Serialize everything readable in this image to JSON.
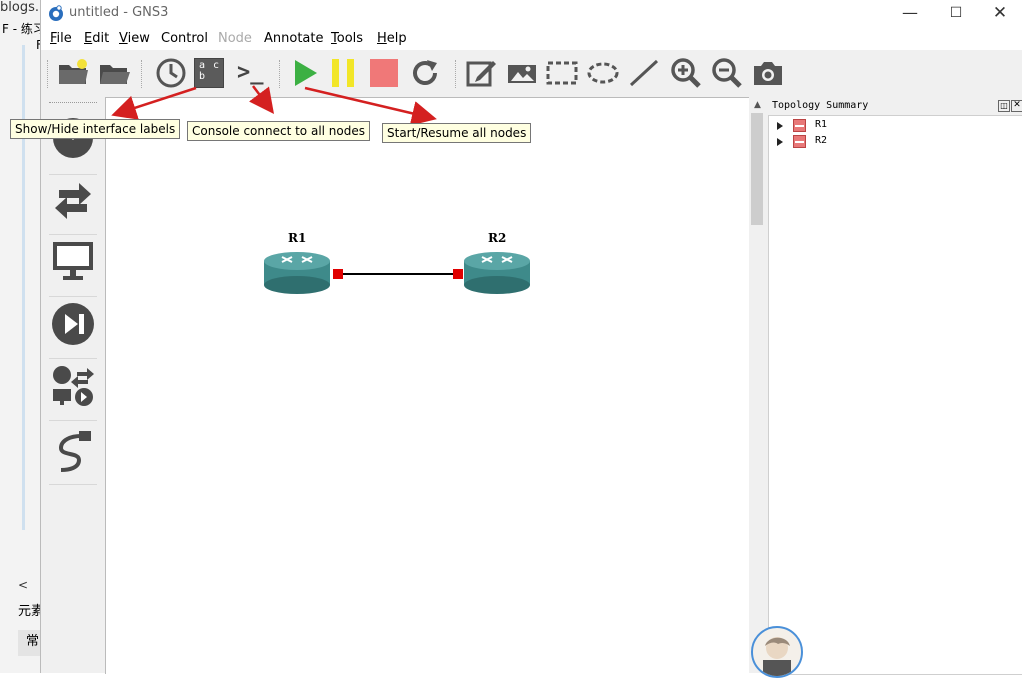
{
  "background": {
    "text_top": "blogs.",
    "text_2": "F - 练习",
    "text_3": "F",
    "scroll_left": "<",
    "text_4": "元素",
    "tab": "常"
  },
  "window": {
    "title": "untitled - GNS3",
    "minimize": "—",
    "maximize": "☐",
    "close": "✕"
  },
  "menu": [
    {
      "label": "File",
      "ul": "F",
      "rest": "ile",
      "disabled": false
    },
    {
      "label": "Edit",
      "ul": "E",
      "rest": "dit",
      "disabled": false
    },
    {
      "label": "View",
      "ul": "V",
      "rest": "iew",
      "disabled": false
    },
    {
      "label": "Control",
      "ul": "",
      "rest": "Control",
      "disabled": false
    },
    {
      "label": "Node",
      "ul": "",
      "rest": "Node",
      "disabled": true
    },
    {
      "label": "Annotate",
      "ul": "",
      "rest": "Annotate",
      "disabled": false
    },
    {
      "label": "Tools",
      "ul": "T",
      "rest": "ools",
      "disabled": false
    },
    {
      "label": "Help",
      "ul": "H",
      "rest": "elp",
      "disabled": false
    }
  ],
  "toolbar": {
    "labels_icon_text": "a c b",
    "console_text": ">_"
  },
  "tooltips": {
    "labels": "Show/Hide interface labels",
    "console": "Console connect to all nodes",
    "start": "Start/Resume all nodes"
  },
  "topology": {
    "title": "Topology Summary",
    "float": "◫",
    "close": "✕",
    "items": [
      {
        "label": "R1"
      },
      {
        "label": "R2"
      }
    ]
  },
  "nodes": [
    {
      "label": "R1"
    },
    {
      "label": "R2"
    }
  ],
  "colors": {
    "router": "#3e8a8a",
    "link_endpoint": "#e00000",
    "arrow": "#d42020",
    "start": "#3cb043",
    "pause": "#f2e628",
    "stop": "#f07878"
  }
}
